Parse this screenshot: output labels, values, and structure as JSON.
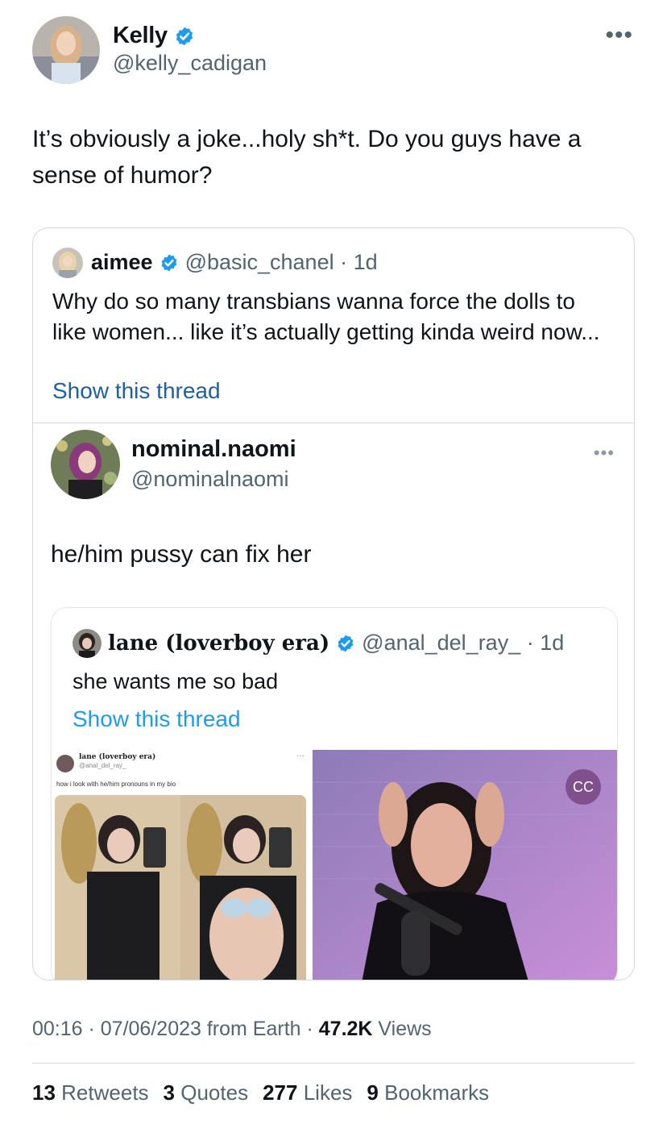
{
  "tweet": {
    "author_name": "Kelly",
    "author_handle": "@kelly_cadigan",
    "more": "•••",
    "text": "It’s obviously a joke...holy sh*t. Do you guys have a sense of humor?"
  },
  "quote1": {
    "author_name": "aimee",
    "author_handle": "@basic_chanel · 1d",
    "text": "Why do so many transbians wanna force the dolls to like women... like it’s actually getting kinda weird now...",
    "show_thread": "Show this thread"
  },
  "quote2": {
    "author_name": "nominal.naomi",
    "author_handle": "@nominalnaomi",
    "more": "•••",
    "text": "he/him pussy can fix her"
  },
  "quote3": {
    "author_name": "lane (loverboy era)",
    "author_handle": "@anal_del_ray_ · 1d",
    "text": "she wants me so bad",
    "show_thread": "Show this thread",
    "embedded": {
      "name": "lane (loverboy era)",
      "handle": "@anal_del_ray_",
      "text": "how i look with he/him pronouns in my bio",
      "more": "···"
    },
    "cc_badge": "CC"
  },
  "meta": {
    "time": "00:16 · 07/06/2023 from Earth · ",
    "views_count": "47.2K",
    "views_label": " Views"
  },
  "stats": {
    "retweets_count": "13",
    "retweets_label": "Retweets",
    "quotes_count": "3",
    "quotes_label": "Quotes",
    "likes_count": "277",
    "likes_label": "Likes",
    "bookmarks_count": "9",
    "bookmarks_label": "Bookmarks"
  },
  "colors": {
    "verified": "#1d9bf0",
    "link": "#1d9bf0",
    "secondary_text": "#536471"
  }
}
